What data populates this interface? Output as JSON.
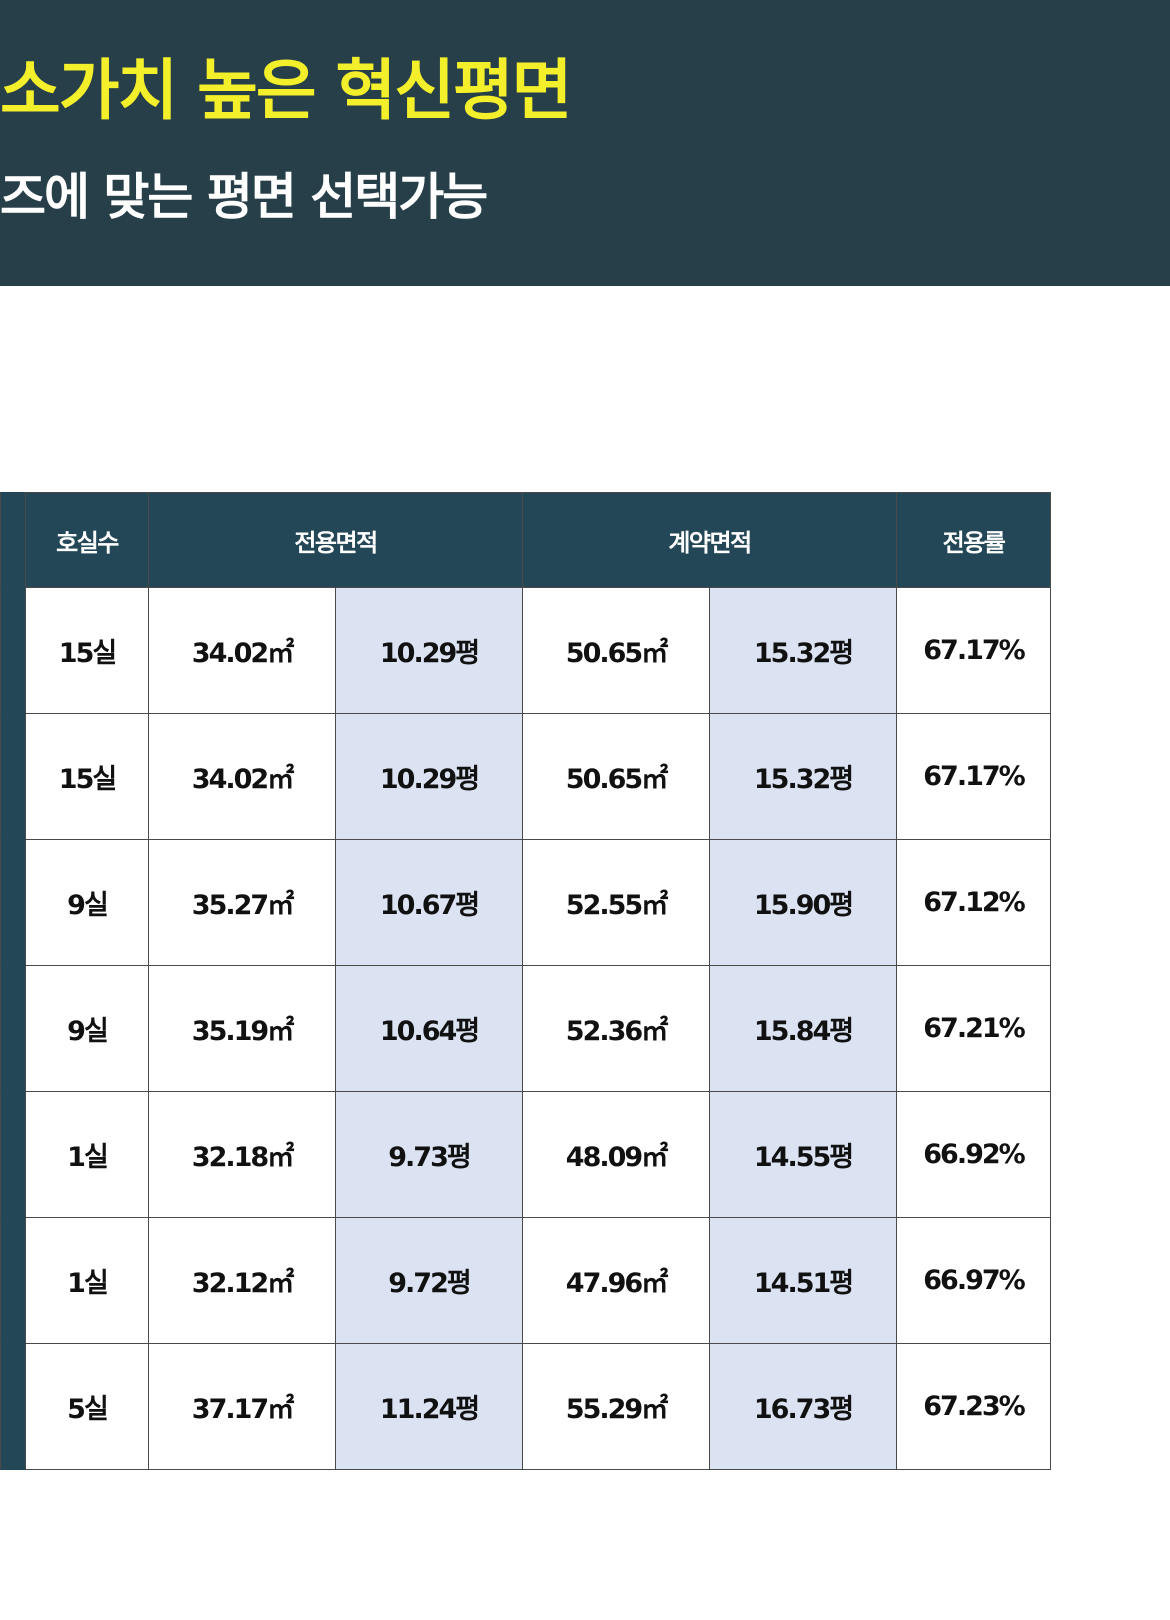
{
  "header": {
    "headline": "소가치 높은 혁신평면",
    "subline": "즈에 맞는 평면 선택가능"
  },
  "colors": {
    "banner_bg": "#273f49",
    "headline": "#f3ef2a",
    "table_header_bg": "#234757",
    "pyeong_cell_bg": "#dbe3f3"
  },
  "table": {
    "headers": {
      "rooms": "호실수",
      "exclusive_area": "전용면적",
      "contract_area": "계약면적",
      "ratio": "전용률"
    },
    "rows": [
      {
        "rooms": "15실",
        "excl_m2": "34.02㎡",
        "excl_py": "10.29평",
        "cont_m2": "50.65㎡",
        "cont_py": "15.32평",
        "ratio": "67.17%"
      },
      {
        "rooms": "15실",
        "excl_m2": "34.02㎡",
        "excl_py": "10.29평",
        "cont_m2": "50.65㎡",
        "cont_py": "15.32평",
        "ratio": "67.17%"
      },
      {
        "rooms": "9실",
        "excl_m2": "35.27㎡",
        "excl_py": "10.67평",
        "cont_m2": "52.55㎡",
        "cont_py": "15.90평",
        "ratio": "67.12%"
      },
      {
        "rooms": "9실",
        "excl_m2": "35.19㎡",
        "excl_py": "10.64평",
        "cont_m2": "52.36㎡",
        "cont_py": "15.84평",
        "ratio": "67.21%"
      },
      {
        "rooms": "1실",
        "excl_m2": "32.18㎡",
        "excl_py": "9.73평",
        "cont_m2": "48.09㎡",
        "cont_py": "14.55평",
        "ratio": "66.92%"
      },
      {
        "rooms": "1실",
        "excl_m2": "32.12㎡",
        "excl_py": "9.72평",
        "cont_m2": "47.96㎡",
        "cont_py": "14.51평",
        "ratio": "66.97%"
      },
      {
        "rooms": "5실",
        "excl_m2": "37.17㎡",
        "excl_py": "11.24평",
        "cont_m2": "55.29㎡",
        "cont_py": "16.73평",
        "ratio": "67.23%"
      }
    ]
  }
}
